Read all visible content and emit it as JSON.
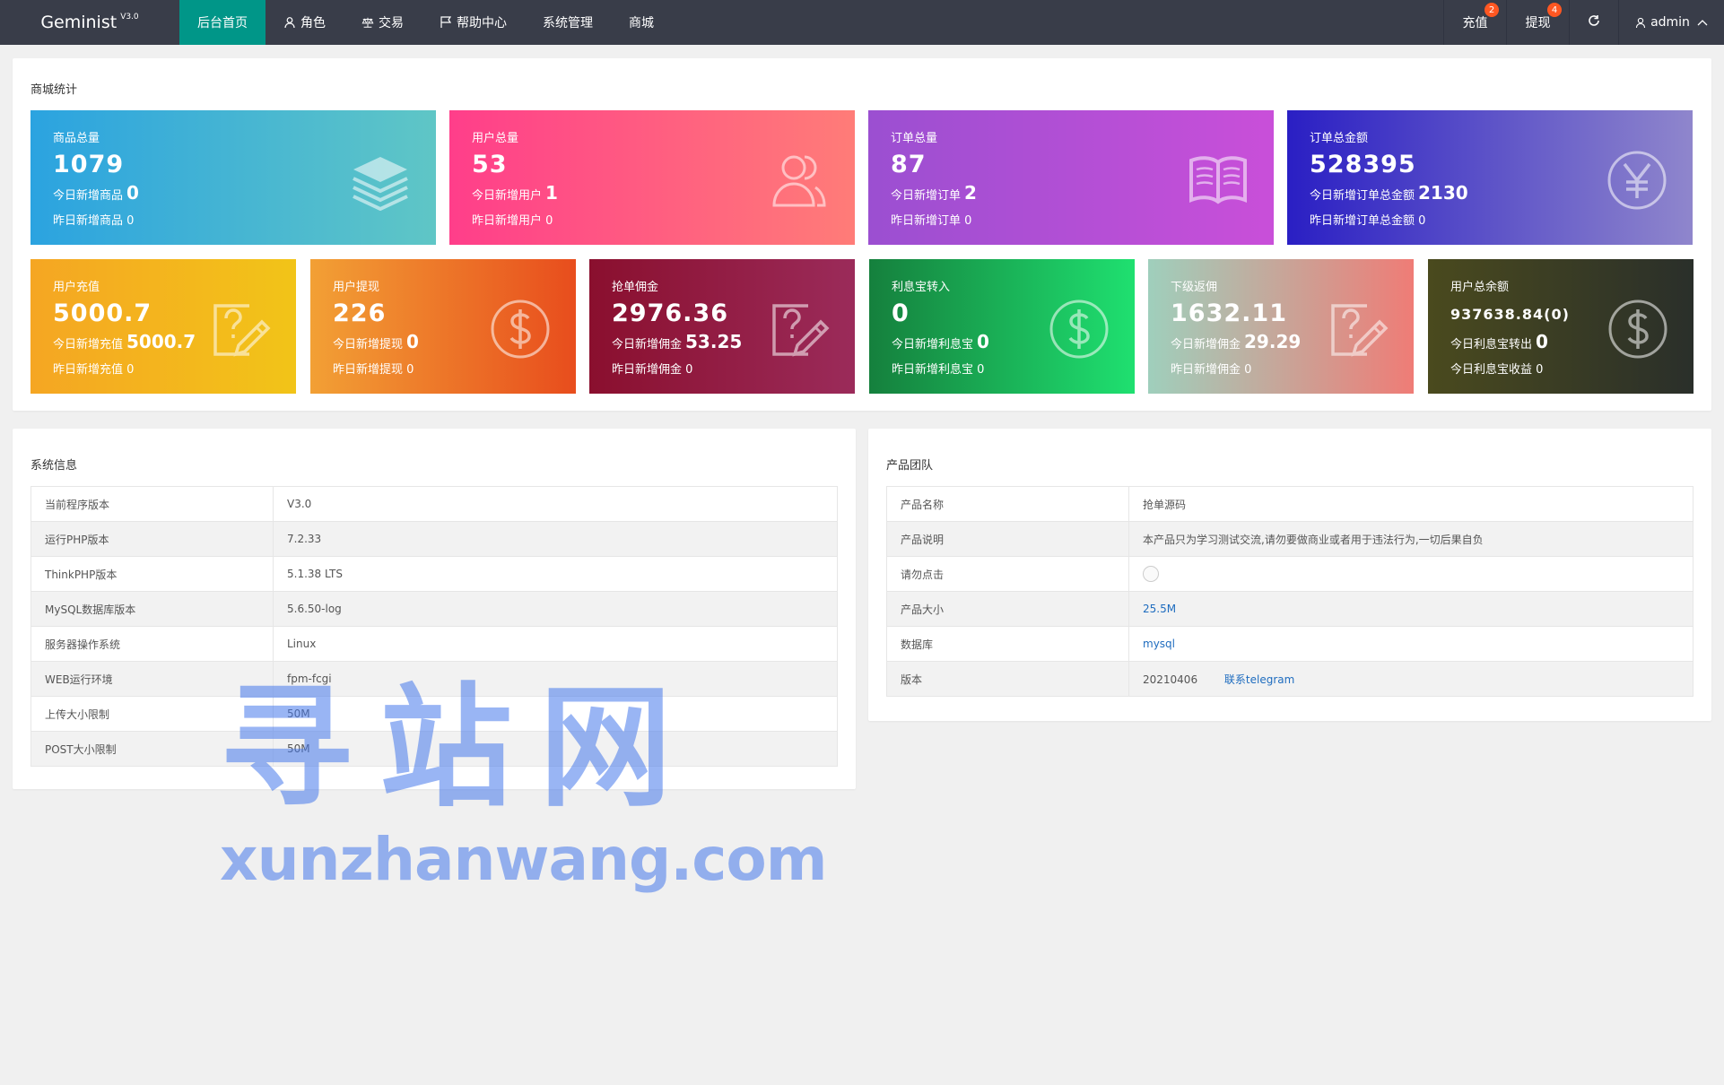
{
  "app": {
    "name": "Geminist",
    "version": "V3.0"
  },
  "nav": [
    {
      "label": "后台首页",
      "icon": "",
      "active": true
    },
    {
      "label": "角色",
      "icon": "user-icon"
    },
    {
      "label": "交易",
      "icon": "scale-icon"
    },
    {
      "label": "帮助中心",
      "icon": "flag-icon"
    },
    {
      "label": "系统管理",
      "icon": ""
    },
    {
      "label": "商城",
      "icon": ""
    }
  ],
  "right_nav": {
    "recharge": {
      "label": "充值",
      "badge": "2"
    },
    "withdraw": {
      "label": "提现",
      "badge": "4"
    },
    "refresh_icon": "refresh-icon",
    "user": {
      "label": "admin",
      "icon": "user-icon",
      "caret": "chevron-up-icon"
    }
  },
  "stats": {
    "title": "商城统计",
    "row1": [
      {
        "title": "商品总量",
        "value": "1079",
        "today_label": "今日新增商品",
        "today_value": "0",
        "yesterday": "昨日新增商品 0",
        "icon": "layers-icon",
        "gradient": [
          "#2ba3e0",
          "#5fc6c6"
        ]
      },
      {
        "title": "用户总量",
        "value": "53",
        "today_label": "今日新增用户",
        "today_value": "1",
        "yesterday": "昨日新增用户 0",
        "icon": "users-icon",
        "gradient": [
          "#ff3e8a",
          "#ff7c78"
        ]
      },
      {
        "title": "订单总量",
        "value": "87",
        "today_label": "今日新增订单",
        "today_value": "2",
        "yesterday": "昨日新增订单 0",
        "icon": "book-icon",
        "gradient": [
          "#9b4fd1",
          "#c94fd9"
        ]
      },
      {
        "title": "订单总金额",
        "value": "528395",
        "today_label": "今日新增订单总金额",
        "today_value": "2130",
        "yesterday": "昨日新增订单总金额 0",
        "icon": "yen-icon",
        "gradient": [
          "#2a1fc4",
          "#8f86cc"
        ]
      }
    ],
    "row2": [
      {
        "title": "用户充值",
        "value": "5000.7",
        "today_label": "今日新增充值",
        "today_value": "5000.7",
        "yesterday": "昨日新增充值 0",
        "icon": "edit-question-icon",
        "gradient": [
          "#f5a623",
          "#f2c418"
        ]
      },
      {
        "title": "用户提现",
        "value": "226",
        "today_label": "今日新增提现",
        "today_value": "0",
        "yesterday": "昨日新增提现 0",
        "icon": "dollar-circle-icon",
        "gradient": [
          "#f2a035",
          "#e84d1d"
        ]
      },
      {
        "title": "抢单佣金",
        "value": "2976.36",
        "today_label": "今日新增佣金",
        "today_value": "53.25",
        "yesterday": "昨日新增佣金 0",
        "icon": "edit-question-icon",
        "gradient": [
          "#8a0f2e",
          "#9b2b5a"
        ]
      },
      {
        "title": "利息宝转入",
        "value": "0",
        "today_label": "今日新增利息宝",
        "today_value": "0",
        "yesterday": "昨日新增利息宝 0",
        "icon": "dollar-circle-icon",
        "gradient": [
          "#15803d",
          "#1fe070"
        ]
      },
      {
        "title": "下级返佣",
        "value": "1632.11",
        "today_label": "今日新增佣金",
        "today_value": "29.29",
        "yesterday": "昨日新增佣金 0",
        "icon": "edit-question-icon",
        "gradient": [
          "#9fcfbc",
          "#ef7c76"
        ]
      },
      {
        "title": "用户总余额",
        "value": "937638.84(0)",
        "today_label": "今日利息宝转出",
        "today_value": "0",
        "yesterday": "今日利息宝收益 0",
        "icon": "dollar-circle-icon",
        "gradient": [
          "#4a4a1e",
          "#2a2f2a"
        ]
      }
    ]
  },
  "system_info": {
    "title": "系统信息",
    "rows": [
      {
        "label": "当前程序版本",
        "value": "V3.0"
      },
      {
        "label": "运行PHP版本",
        "value": "7.2.33"
      },
      {
        "label": "ThinkPHP版本",
        "value": "5.1.38 LTS"
      },
      {
        "label": "MySQL数据库版本",
        "value": "5.6.50-log"
      },
      {
        "label": "服务器操作系统",
        "value": "Linux"
      },
      {
        "label": "WEB运行环境",
        "value": "fpm-fcgi"
      },
      {
        "label": "上传大小限制",
        "value": "50M"
      },
      {
        "label": "POST大小限制",
        "value": "50M"
      }
    ]
  },
  "product_team": {
    "title": "产品团队",
    "rows": [
      {
        "label": "产品名称",
        "value": "抢单源码"
      },
      {
        "label": "产品说明",
        "value": "本产品只为学习测试交流,请勿要做商业或者用于违法行为,一切后果自负"
      },
      {
        "label": "请勿点击",
        "value": ""
      },
      {
        "label": "产品大小",
        "value": "25.5M"
      },
      {
        "label": "数据库",
        "value": "mysql"
      },
      {
        "label": "版本",
        "value": "20210406",
        "extra": "联系telegram"
      }
    ]
  },
  "watermark": {
    "line1": "寻站网",
    "line2": "xunzhanwang.com"
  }
}
